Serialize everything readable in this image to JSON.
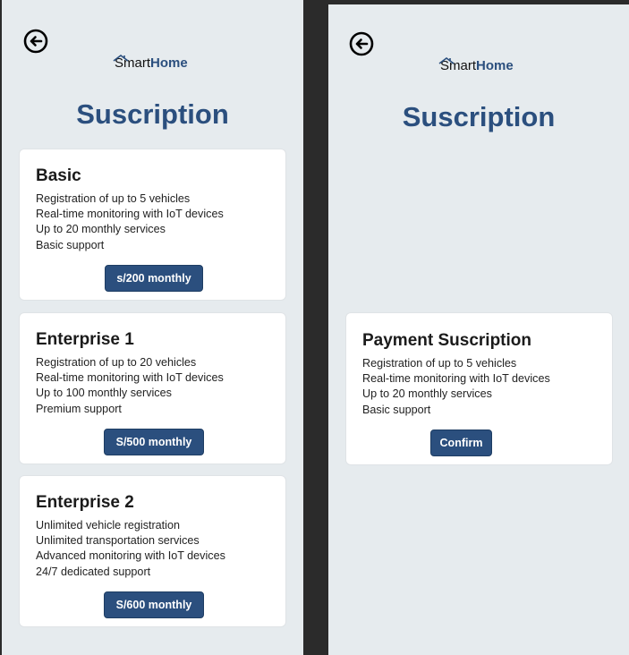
{
  "brand": {
    "smart": "Smart",
    "home": "Home"
  },
  "left_screen": {
    "title": "Suscription",
    "plans": [
      {
        "name": "Basic",
        "features": [
          "Registration of up to 5 vehicles",
          "Real-time monitoring with IoT devices",
          "Up to 20 monthly services",
          "Basic support"
        ],
        "price_label": "s/200 monthly"
      },
      {
        "name": "Enterprise 1",
        "features": [
          "Registration of up to 20 vehicles",
          "Real-time monitoring with IoT devices",
          "Up to 100 monthly services",
          "Premium support"
        ],
        "price_label": "S/500 monthly"
      },
      {
        "name": "Enterprise 2",
        "features": [
          "Unlimited vehicle registration",
          "Unlimited transportation services",
          "Advanced monitoring with IoT devices",
          "24/7 dedicated support"
        ],
        "price_label": "S/600 monthly"
      }
    ]
  },
  "right_screen": {
    "title": "Suscription",
    "payment_card": {
      "title": "Payment Suscription",
      "features": [
        "Registration of up to 5 vehicles",
        "Real-time monitoring with IoT devices",
        "Up to 20 monthly services",
        "Basic support"
      ],
      "confirm_label": "Confirm"
    }
  },
  "icons": {
    "back": "back-arrow-circle-icon",
    "logo": "house-roof-icon"
  },
  "colors": {
    "primary": "#2b4f7e",
    "screen_bg": "#e6ebee",
    "card_bg": "#ffffff",
    "frame_bg": "#2b2b2b"
  }
}
